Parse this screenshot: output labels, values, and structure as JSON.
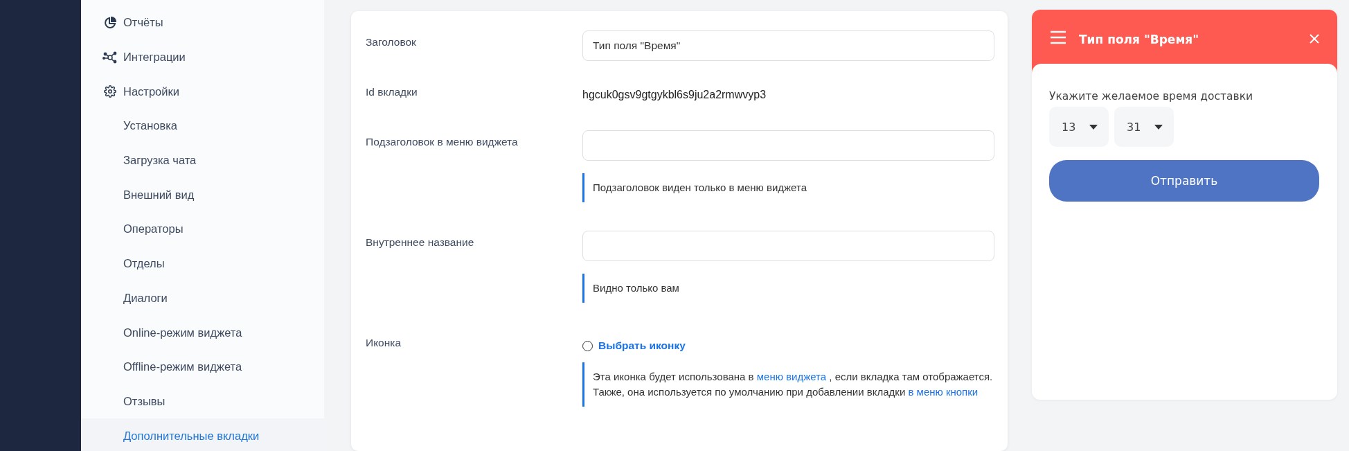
{
  "sidebar": {
    "items": [
      {
        "label": "Отчёты",
        "selected": false
      },
      {
        "label": "Интеграции",
        "selected": false
      },
      {
        "label": "Настройки",
        "selected": false,
        "children": [
          {
            "label": "Установка",
            "selected": false
          },
          {
            "label": "Загрузка чата",
            "selected": false
          },
          {
            "label": "Внешний вид",
            "selected": false
          },
          {
            "label": "Операторы",
            "selected": false
          },
          {
            "label": "Отделы",
            "selected": false
          },
          {
            "label": "Диалоги",
            "selected": false
          },
          {
            "label": "Online-режим виджета",
            "selected": false
          },
          {
            "label": "Offline-режим виджета",
            "selected": false
          },
          {
            "label": "Отзывы",
            "selected": false
          },
          {
            "label": "Дополнительные вкладки",
            "selected": true
          }
        ]
      }
    ]
  },
  "form": {
    "fields": [
      {
        "kind": "input",
        "label": "Заголовок",
        "value": "Тип поля \"Время\""
      },
      {
        "kind": "text",
        "label": "Id вкладки",
        "value": "hgcuk0gsv9gtgykbl6s9ju2a2rmwvyp3"
      },
      {
        "kind": "input",
        "label": "Подзаголовок в меню виджета",
        "hint": [
          [
            {
              "text": "Подзаголовок виден только в меню виджета"
            }
          ]
        ]
      },
      {
        "kind": "input",
        "label": "Внутреннее название",
        "hint": [
          [
            {
              "text": "Видно только вам"
            }
          ]
        ]
      },
      {
        "kind": "icon-picker",
        "label": "Иконка",
        "checked": false,
        "link": "Выбрать иконку",
        "hint": [
          [
            {
              "text": "Эта иконка будет использована в "
            },
            {
              "link": "меню виджета"
            },
            {
              "text": " , если вкладка там отображается."
            }
          ],
          [
            {
              "text": "Также, она используется по умолчанию при добавлении вкладки "
            },
            {
              "link": "в меню кнопки"
            }
          ]
        ]
      }
    ]
  },
  "widget": {
    "title": "Тип поля \"Время\"",
    "prompt": "Укажите желаемое время доставки",
    "selects": [
      {
        "value": "13"
      },
      {
        "value": "31"
      }
    ],
    "submit": "Отправить"
  }
}
